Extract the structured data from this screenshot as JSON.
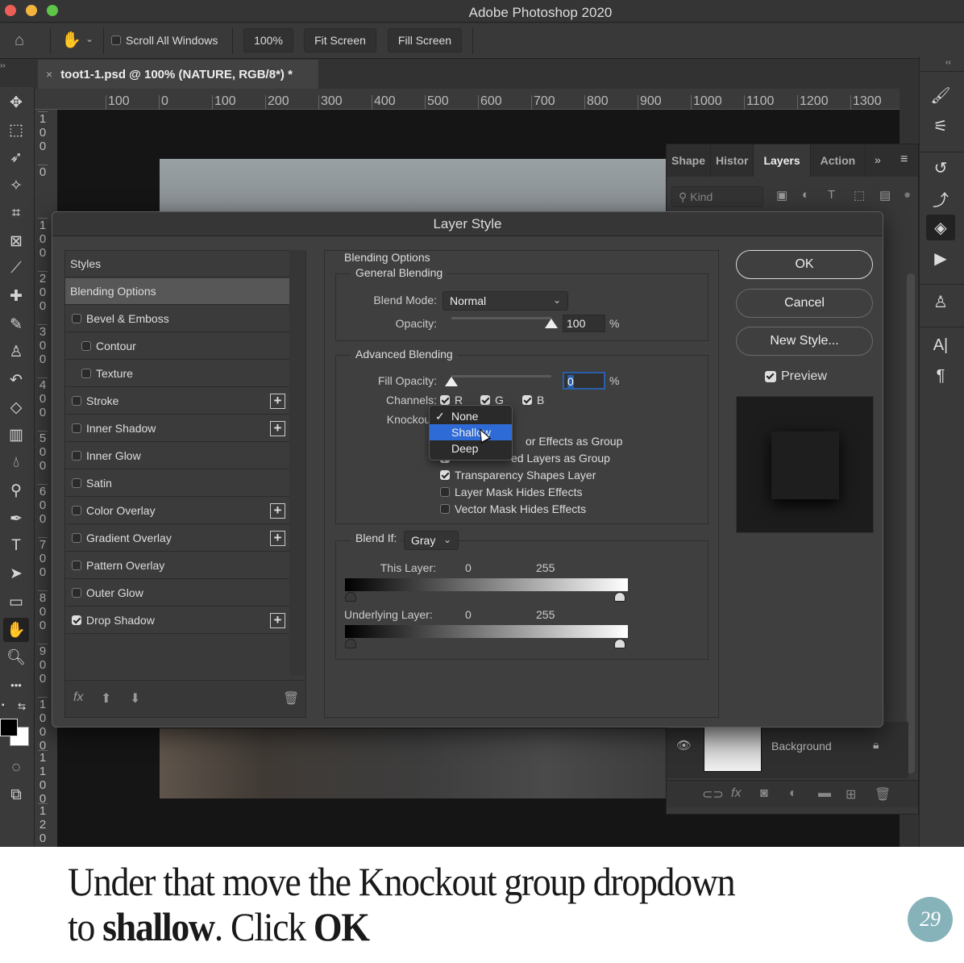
{
  "window": {
    "title": "Adobe Photoshop 2020"
  },
  "options_bar": {
    "scroll_all_windows_label": "Scroll All Windows",
    "scroll_all_windows_checked": false,
    "zoom_100_label": "100%",
    "fit_screen_label": "Fit Screen",
    "fill_screen_label": "Fill Screen"
  },
  "document_tab": {
    "close_glyph": "×",
    "title": "toot1-1.psd @ 100% (NATURE, RGB/8*) *"
  },
  "ruler": {
    "top_labels": [
      "100",
      "0",
      "100",
      "200",
      "300",
      "400",
      "500",
      "600",
      "700",
      "800",
      "900",
      "1000",
      "1100",
      "1200",
      "1300"
    ],
    "left_labels": [
      "100",
      "0",
      "100",
      "200",
      "300",
      "400",
      "500",
      "600",
      "700",
      "800",
      "900",
      "1000",
      "1100",
      "1200"
    ]
  },
  "tools": [
    "move",
    "marquee",
    "lasso",
    "magic-wand",
    "crop",
    "frame",
    "eyedropper",
    "healing-brush",
    "brush",
    "clone-stamp",
    "history-brush",
    "eraser",
    "gradient",
    "blur",
    "dodge",
    "pen",
    "type",
    "path-selection",
    "rectangle",
    "hand",
    "zoom",
    "more",
    "default-colors",
    "swap-colors",
    "quick-mask",
    "screen-mode"
  ],
  "active_tool": "hand",
  "colors": {
    "foreground": "#000000",
    "background": "#ffffff",
    "accent": "#2f6bd6"
  },
  "layers_panel": {
    "tabs": [
      "Shape",
      "Histor",
      "Layers",
      "Action"
    ],
    "active_tab": "Layers",
    "filter_placeholder": "Kind",
    "layer": {
      "name": "Background",
      "visible": true,
      "locked": true
    }
  },
  "dialog": {
    "title": "Layer Style",
    "styles_header": "Styles",
    "styles": [
      {
        "label": "Blending Options",
        "checkbox": false,
        "selected": true,
        "plus": false,
        "indent": false
      },
      {
        "label": "Bevel & Emboss",
        "checkbox": true,
        "checked": false,
        "plus": false,
        "indent": false
      },
      {
        "label": "Contour",
        "checkbox": true,
        "checked": false,
        "plus": false,
        "indent": true
      },
      {
        "label": "Texture",
        "checkbox": true,
        "checked": false,
        "plus": false,
        "indent": true
      },
      {
        "label": "Stroke",
        "checkbox": true,
        "checked": false,
        "plus": true,
        "indent": false
      },
      {
        "label": "Inner Shadow",
        "checkbox": true,
        "checked": false,
        "plus": true,
        "indent": false
      },
      {
        "label": "Inner Glow",
        "checkbox": true,
        "checked": false,
        "plus": false,
        "indent": false
      },
      {
        "label": "Satin",
        "checkbox": true,
        "checked": false,
        "plus": false,
        "indent": false
      },
      {
        "label": "Color Overlay",
        "checkbox": true,
        "checked": false,
        "plus": true,
        "indent": false
      },
      {
        "label": "Gradient Overlay",
        "checkbox": true,
        "checked": false,
        "plus": true,
        "indent": false
      },
      {
        "label": "Pattern Overlay",
        "checkbox": true,
        "checked": false,
        "plus": false,
        "indent": false
      },
      {
        "label": "Outer Glow",
        "checkbox": true,
        "checked": false,
        "plus": false,
        "indent": false
      },
      {
        "label": "Drop Shadow",
        "checkbox": true,
        "checked": true,
        "plus": true,
        "indent": false
      }
    ],
    "blending_options": {
      "title": "Blending Options",
      "general": {
        "title": "General Blending",
        "blend_mode_label": "Blend Mode:",
        "blend_mode": "Normal",
        "opacity_label": "Opacity:",
        "opacity": "100",
        "percent": "%"
      },
      "advanced": {
        "title": "Advanced Blending",
        "fill_opacity_label": "Fill Opacity:",
        "fill_opacity": "0",
        "percent": "%",
        "channels_label": "Channels:",
        "channels": [
          {
            "label": "R",
            "checked": true
          },
          {
            "label": "G",
            "checked": true
          },
          {
            "label": "B",
            "checked": true
          }
        ],
        "knockout_label": "Knockout:",
        "knockout_options": [
          "None",
          "Shallow",
          "Deep"
        ],
        "knockout_checked": "None",
        "knockout_highlighted": "Shallow",
        "checkboxes": [
          {
            "label": "Blend Interior Effects as Group",
            "visible_text": "or Effects as Group",
            "checked": false
          },
          {
            "label": "Blend Clipped Layers as Group",
            "visible_text": "ed Layers as Group",
            "checked": true
          },
          {
            "label": "Transparency Shapes Layer",
            "visible_text": "Transparency Shapes Layer",
            "checked": true
          },
          {
            "label": "Layer Mask Hides Effects",
            "visible_text": "Layer Mask Hides Effects",
            "checked": false
          },
          {
            "label": "Vector Mask Hides Effects",
            "visible_text": "Vector Mask Hides Effects",
            "checked": false
          }
        ]
      },
      "blend_if": {
        "label": "Blend If:",
        "channel": "Gray",
        "this_layer_label": "This Layer:",
        "this_layer_low": "0",
        "this_layer_high": "255",
        "underlying_label": "Underlying Layer:",
        "underlying_low": "0",
        "underlying_high": "255"
      }
    },
    "buttons": {
      "ok": "OK",
      "cancel": "Cancel",
      "new_style": "New Style..."
    },
    "preview_label": "Preview",
    "preview_checked": true
  },
  "caption": {
    "line1": "Under that move the Knockout group dropdown",
    "line2_pre": "to ",
    "line2_bold1": "shallow",
    "line2_mid": ". Click ",
    "line2_bold2": "OK",
    "logo_text": "29"
  }
}
